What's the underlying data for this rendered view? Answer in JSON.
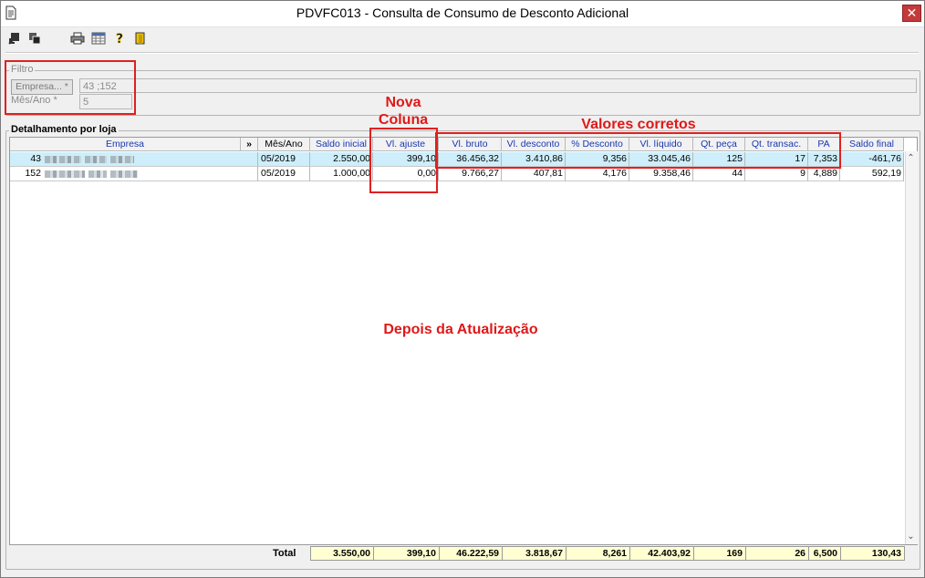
{
  "window": {
    "title": "PDVFC013 - Consulta de Consumo de Desconto Adicional",
    "close_glyph": "✕"
  },
  "toolbar": {
    "icons": [
      "exit-icon",
      "windows-icon",
      "print-icon",
      "grid-icon",
      "help-icon",
      "door-icon"
    ]
  },
  "filtro": {
    "legend": "Filtro",
    "empresa_button": "Empresa... *",
    "empresa_value": "43 ;152",
    "mesano_label": "Mês/Ano *",
    "mesano_value": "5"
  },
  "detalhe": {
    "legend": "Detalhamento por loja",
    "expand_glyph": "»",
    "columns": [
      "Empresa",
      "Mês/Ano",
      "Saldo inicial",
      "Vl. ajuste",
      "Vl. bruto",
      "Vl. desconto",
      "% Desconto",
      "Vl. líquido",
      "Qt. peça",
      "Qt. transac.",
      "PA",
      "Saldo final"
    ],
    "rows": [
      {
        "codigo": "43",
        "mes_ano": "05/2019",
        "saldo_inicial": "2.550,00",
        "vl_ajuste": "399,10",
        "vl_bruto": "36.456,32",
        "vl_desconto": "3.410,86",
        "pct_desconto": "9,356",
        "vl_liquido": "33.045,46",
        "qt_peca": "125",
        "qt_transac": "17",
        "pa": "7,353",
        "saldo_final": "-461,76"
      },
      {
        "codigo": "152",
        "mes_ano": "05/2019",
        "saldo_inicial": "1.000,00",
        "vl_ajuste": "0,00",
        "vl_bruto": "9.766,27",
        "vl_desconto": "407,81",
        "pct_desconto": "4,176",
        "vl_liquido": "9.358,46",
        "qt_peca": "44",
        "qt_transac": "9",
        "pa": "4,889",
        "saldo_final": "592,19"
      }
    ],
    "total": {
      "label": "Total",
      "saldo_inicial": "3.550,00",
      "vl_ajuste": "399,10",
      "vl_bruto": "46.222,59",
      "vl_desconto": "3.818,67",
      "pct_desconto": "8,261",
      "vl_liquido": "42.403,92",
      "qt_peca": "169",
      "qt_transac": "26",
      "pa": "6,500",
      "saldo_final": "130,43"
    }
  },
  "annotations": {
    "nova_coluna_line1": "Nova",
    "nova_coluna_line2": "Coluna",
    "valores_corretos": "Valores corretos",
    "depois": "Depois da Atualização",
    "color": "#e01818"
  },
  "colors": {
    "header_text": "#1a37b0",
    "selected_row": "#cdeefa",
    "total_bg": "#ffffd2"
  }
}
